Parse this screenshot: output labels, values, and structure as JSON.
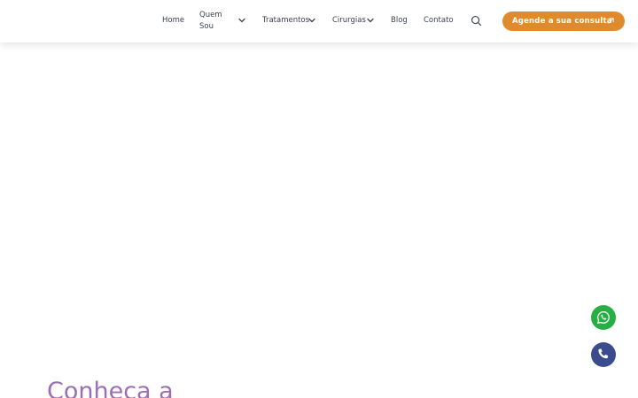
{
  "header": {
    "nav": {
      "home": "Home",
      "quem_sou": "Quem Sou",
      "tratamentos": "Tratamentos",
      "cirurgias": "Cirurgias",
      "blog": "Blog",
      "contato": "Contato"
    },
    "search_icon": "search-icon",
    "cta_label": "Agende a sua consulta",
    "cta_icon": "arrow-up-right-icon"
  },
  "main": {
    "heading": "Conheça a"
  },
  "floating": {
    "whatsapp_icon": "whatsapp-icon",
    "phone_icon": "phone-icon"
  },
  "colors": {
    "accent": "#e08a2e",
    "heading": "#9c6fb3",
    "whatsapp": "#26b043",
    "phone": "#3b4c8e",
    "nav_text": "#3a3f55"
  }
}
